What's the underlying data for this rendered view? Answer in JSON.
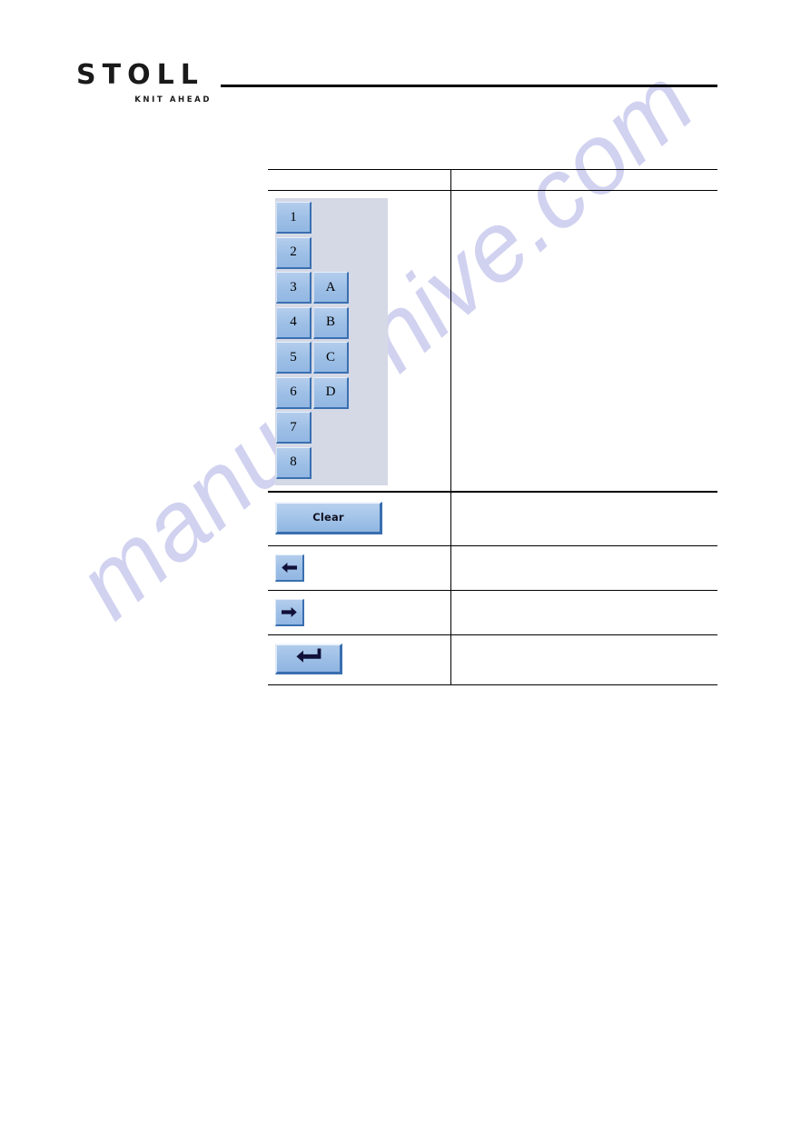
{
  "logo": {
    "wordmark": "STOLL",
    "tagline": "KNIT AHEAD",
    "icon": "stoll-logo"
  },
  "watermark": {
    "text": "manualshive.com"
  },
  "table": {
    "header": {
      "left": "",
      "right": ""
    },
    "rows": [
      {
        "id": "numeric-keypad",
        "left_kind": "keypad",
        "description": ""
      },
      {
        "id": "clear",
        "left_kind": "clear-button",
        "description": ""
      },
      {
        "id": "arrow-left",
        "left_kind": "arrow-left-button",
        "description": ""
      },
      {
        "id": "arrow-right",
        "left_kind": "arrow-right-button",
        "description": ""
      },
      {
        "id": "enter",
        "left_kind": "enter-button",
        "description": ""
      }
    ]
  },
  "keypad": {
    "lines": [
      {
        "number": "1",
        "letter": ""
      },
      {
        "number": "2",
        "letter": ""
      },
      {
        "number": "3",
        "letter": "A"
      },
      {
        "number": "4",
        "letter": "B"
      },
      {
        "number": "5",
        "letter": "C"
      },
      {
        "number": "6",
        "letter": "D"
      },
      {
        "number": "7",
        "letter": ""
      },
      {
        "number": "8",
        "letter": ""
      }
    ]
  },
  "buttons": {
    "clear_label": "Clear",
    "arrow_left_icon": "arrow-left-icon",
    "arrow_right_icon": "arrow-right-icon",
    "enter_icon": "enter-return-icon"
  },
  "colors": {
    "button_face": "#9dbfe6",
    "button_shadow": "#3a6fb0",
    "panel_background": "#d5d9e6",
    "rule": "#000000",
    "watermark": "#c9cbee"
  }
}
